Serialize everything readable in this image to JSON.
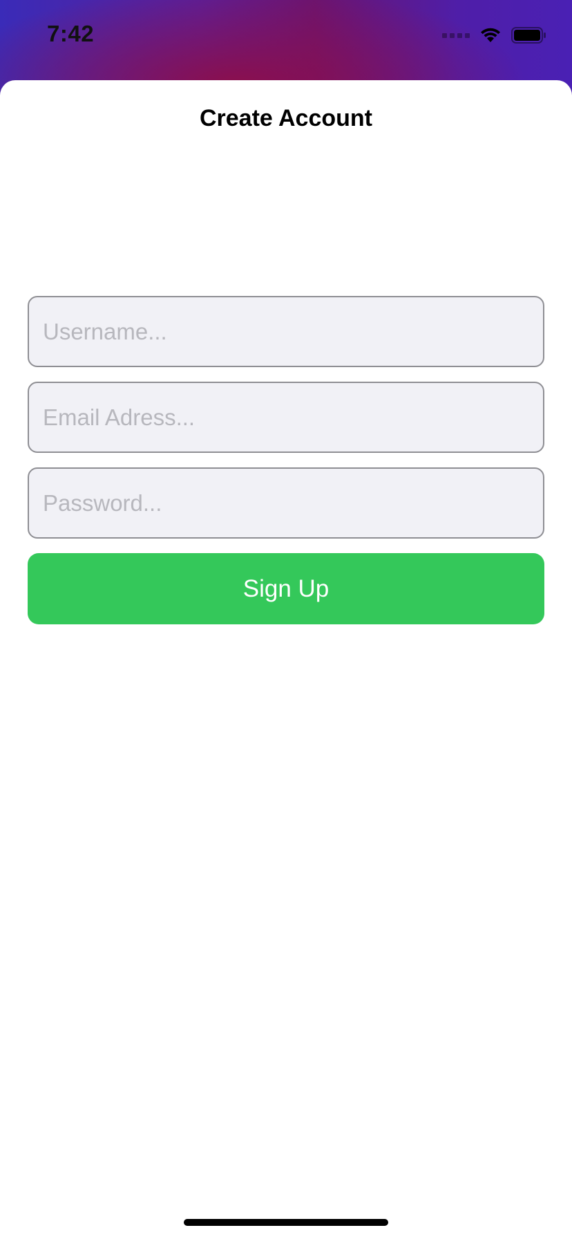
{
  "status_bar": {
    "time": "7:42",
    "icons": [
      "cellular-signal-icon",
      "wifi-icon",
      "battery-icon"
    ]
  },
  "sheet": {
    "title": "Create Account"
  },
  "form": {
    "username": {
      "value": "",
      "placeholder": "Username..."
    },
    "email": {
      "value": "",
      "placeholder": "Email Adress..."
    },
    "password": {
      "value": "",
      "placeholder": "Password..."
    },
    "signup_label": "Sign Up"
  },
  "colors": {
    "accent_green": "#34c85a",
    "field_background": "#f1f1f6",
    "field_border": "#8e8e93",
    "placeholder": "#b7b7bd"
  }
}
